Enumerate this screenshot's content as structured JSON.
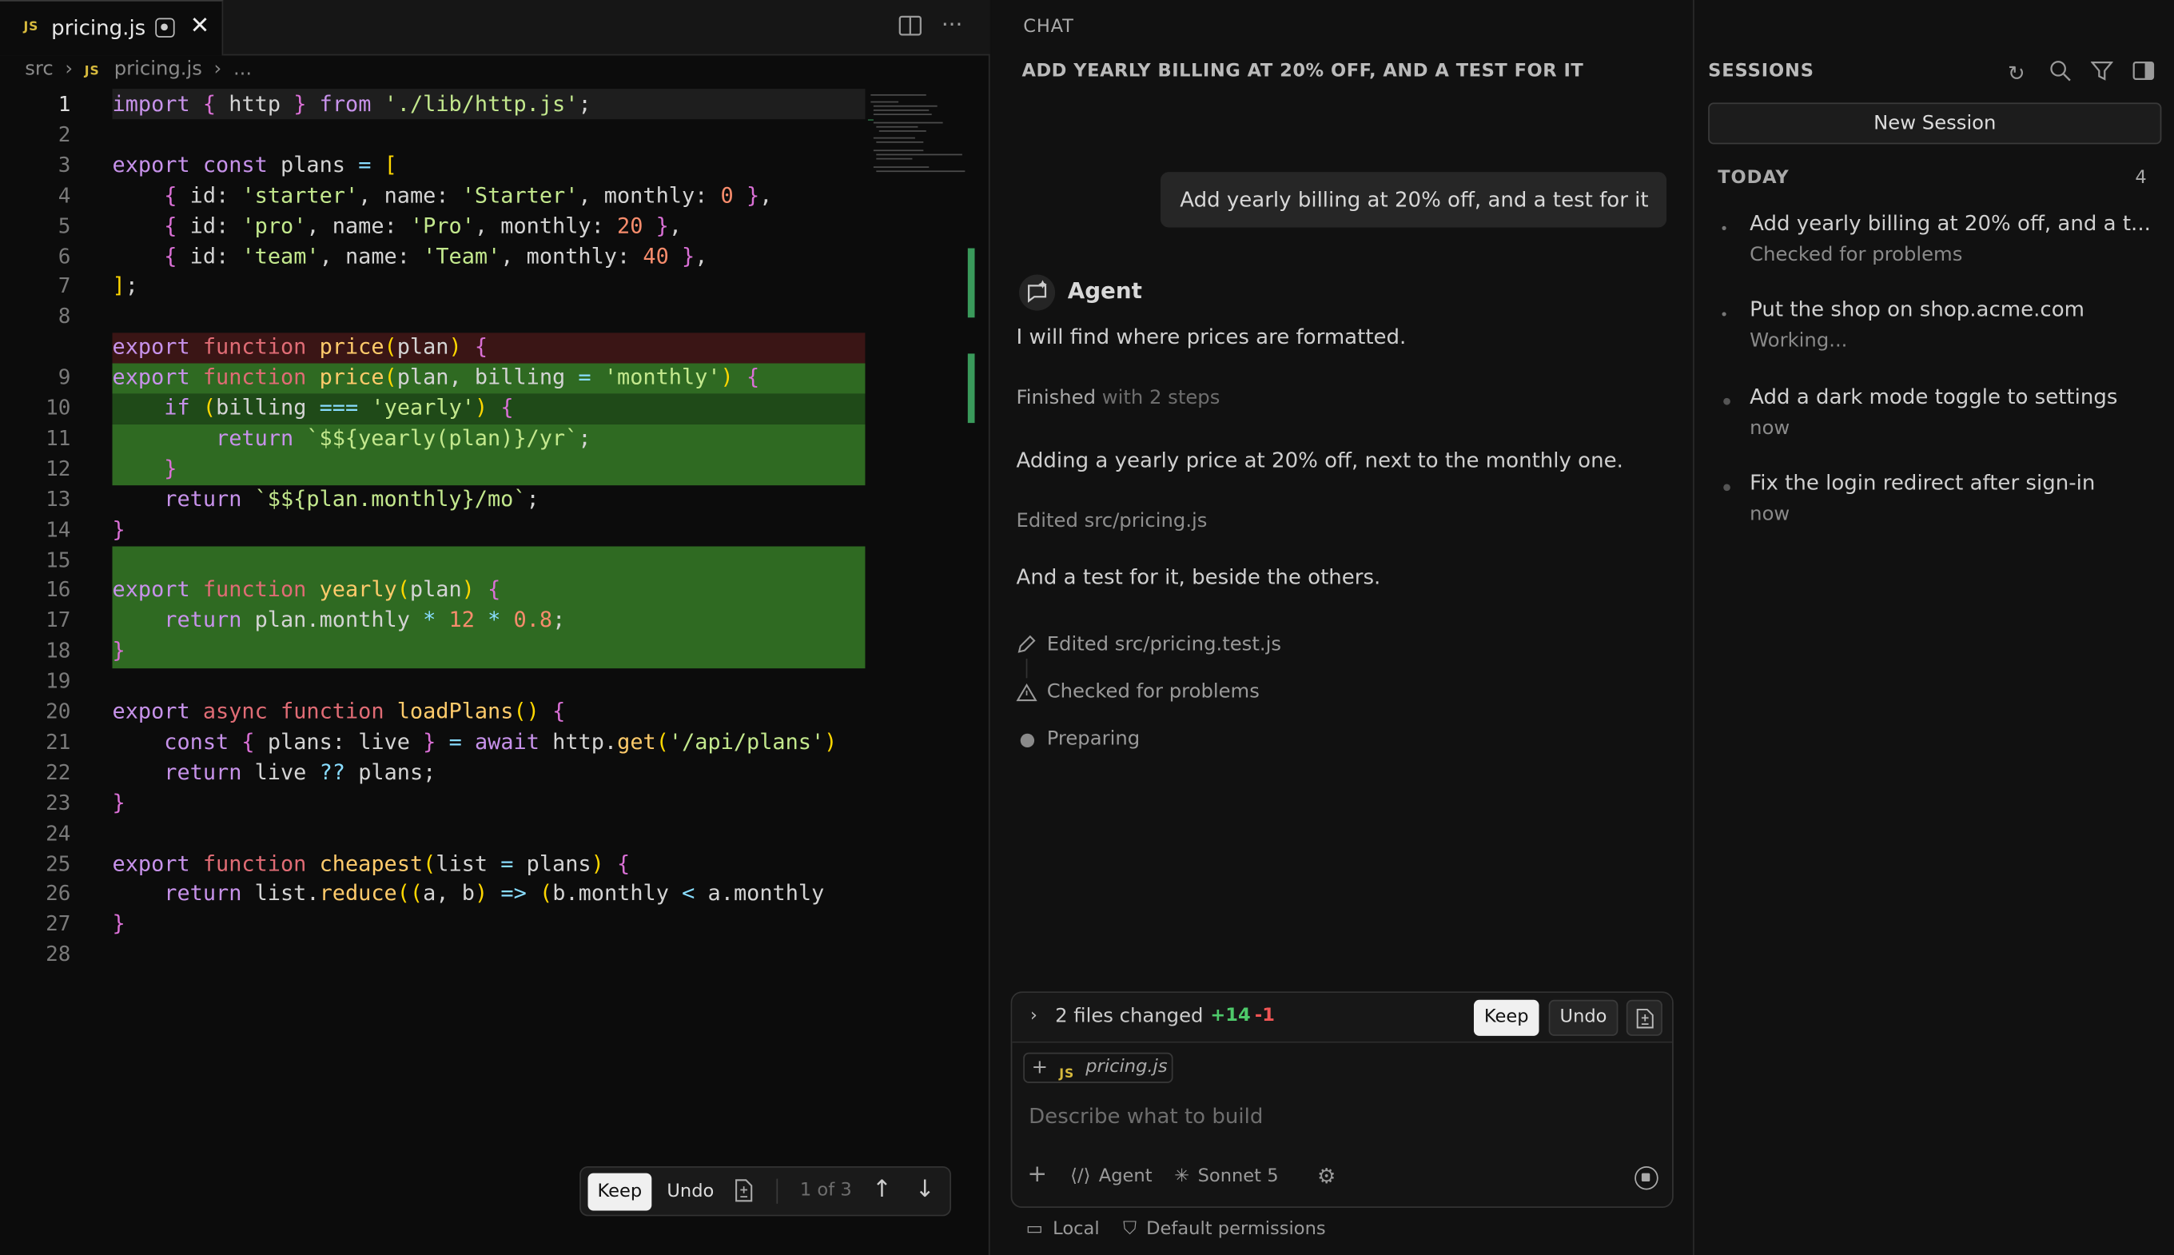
{
  "editor": {
    "tab_badge": "JS",
    "tab_title": "pricing.js",
    "breadcrumb": [
      "src",
      "pricing.js",
      "..."
    ],
    "lines": [
      {
        "n": "1",
        "text": "import { http } from './lib/http.js';"
      },
      {
        "n": "2",
        "text": ""
      },
      {
        "n": "3",
        "text": "export const plans = ["
      },
      {
        "n": "4",
        "text": "    { id: 'starter', name: 'Starter', monthly: 0 },"
      },
      {
        "n": "5",
        "text": "    { id: 'pro', name: 'Pro', monthly: 20 },"
      },
      {
        "n": "6",
        "text": "    { id: 'team', name: 'Team', monthly: 40 },"
      },
      {
        "n": "7",
        "text": "];"
      },
      {
        "n": "8",
        "text": ""
      },
      {
        "n": "",
        "text": "export function price(plan) {"
      },
      {
        "n": "9",
        "text": "export function price(plan, billing = 'monthly') {"
      },
      {
        "n": "10",
        "text": "    if (billing === 'yearly') {"
      },
      {
        "n": "11",
        "text": "        return `$${yearly(plan)}/yr`;"
      },
      {
        "n": "12",
        "text": "    }"
      },
      {
        "n": "13",
        "text": "    return `$${plan.monthly}/mo`;"
      },
      {
        "n": "14",
        "text": "}"
      },
      {
        "n": "15",
        "text": ""
      },
      {
        "n": "16",
        "text": "export function yearly(plan) {"
      },
      {
        "n": "17",
        "text": "    return plan.monthly * 12 * 0.8;"
      },
      {
        "n": "18",
        "text": "}"
      },
      {
        "n": "19",
        "text": ""
      },
      {
        "n": "20",
        "text": "export async function loadPlans() {"
      },
      {
        "n": "21",
        "text": "    const { plans: live } = await http.get('/api/plans')"
      },
      {
        "n": "22",
        "text": "    return live ?? plans;"
      },
      {
        "n": "23",
        "text": "}"
      },
      {
        "n": "24",
        "text": ""
      },
      {
        "n": "25",
        "text": "export function cheapest(list = plans) {"
      },
      {
        "n": "26",
        "text": "    return list.reduce((a, b) => (b.monthly < a.monthly"
      },
      {
        "n": "27",
        "text": "}"
      },
      {
        "n": "28",
        "text": ""
      }
    ],
    "review_bar": {
      "keep": "Keep",
      "undo": "Undo",
      "page": "1 of 3"
    }
  },
  "chat": {
    "panel_title": "CHAT",
    "heading": "ADD YEARLY BILLING AT 20% OFF, AND A TEST FOR IT",
    "user_message": "Add yearly billing at 20% off, and a test for it",
    "agent_name": "Agent",
    "msg1": "I will find where prices are formatted.",
    "finished": "Finished",
    "finished_steps": "with 2 steps",
    "msg2": "Adding a yearly price at 20% off, next to the monthly one.",
    "edited1": "Edited src/pricing.js",
    "msg3": "And a test for it, beside the others.",
    "steps": [
      {
        "icon": "pencil-icon",
        "label": "Edited src/pricing.test.js"
      },
      {
        "icon": "warning-icon",
        "label": "Checked for problems"
      },
      {
        "icon": "dot-icon",
        "label": "Preparing"
      }
    ],
    "composer": {
      "files_changed": "2 files changed",
      "added": "+14",
      "removed": "-1",
      "keep": "Keep",
      "undo": "Undo",
      "chip_badge": "JS",
      "chip_file": "pricing.js",
      "placeholder": "Describe what to build",
      "mode": "Agent",
      "model": "Sonnet 5"
    },
    "footer": {
      "location": "Local",
      "permissions": "Default permissions"
    }
  },
  "sessions": {
    "title": "SESSIONS",
    "new_session": "New Session",
    "group": "TODAY",
    "count": "4",
    "items": [
      {
        "title": "Add yearly billing at 20% off, and a t...",
        "status": "Checked for problems"
      },
      {
        "title": "Put the shop on shop.acme.com",
        "status": "Working..."
      },
      {
        "title": "Add a dark mode toggle to settings",
        "status": "now"
      },
      {
        "title": "Fix the login redirect after sign-in",
        "status": "now"
      }
    ]
  },
  "colors": {
    "accent_green": "#2f6a22",
    "removed_red": "#3a1515",
    "added_text": "#4ec96a",
    "removed_text": "#f05555"
  }
}
